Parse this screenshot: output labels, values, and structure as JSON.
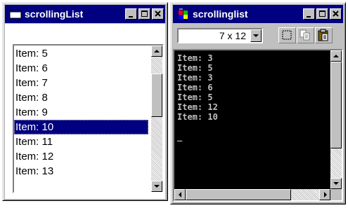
{
  "left_window": {
    "title": "scrollingList",
    "items": [
      "Item: 5",
      "Item: 6",
      "Item: 7",
      "Item: 8",
      "Item: 9",
      "Item: 10",
      "Item: 11",
      "Item: 12",
      "Item: 13"
    ],
    "selected_item": "Item: 10"
  },
  "right_window": {
    "title": "scrollinglist",
    "font_size": "7 x 12",
    "console_lines": [
      "Item: 3",
      "Item: 5",
      "Item: 3",
      "Item: 6",
      "Item: 5",
      "Item: 12",
      "Item: 10"
    ],
    "cursor": "_"
  },
  "icons": {
    "left_title": "window-icon",
    "right_title": "ms-dos-icon",
    "minimize": "minimize-icon",
    "maximize": "maximize-icon",
    "close": "close-icon",
    "mark": "mark-icon",
    "copy": "copy-icon",
    "paste": "paste-icon"
  },
  "colors": {
    "title_bar": "#000080",
    "face": "#c0c0c0",
    "selection": "#000080",
    "console_bg": "#000000",
    "console_text": "#c0c0c0"
  }
}
